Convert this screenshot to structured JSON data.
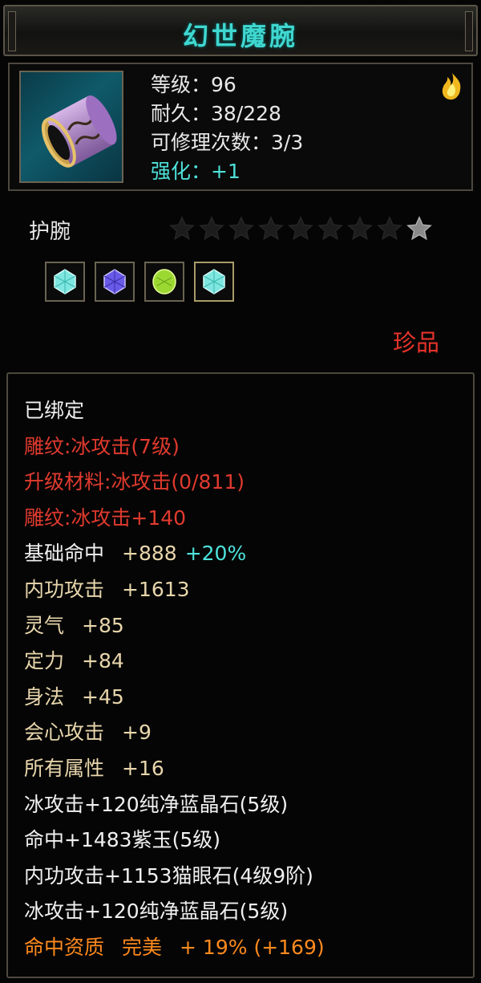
{
  "item": {
    "name": "幻世魔腕",
    "type": "护腕",
    "rarity": "珍品",
    "stats": [
      {
        "label": "等级：",
        "value": "96"
      },
      {
        "label": "耐久：",
        "value": "38/228"
      },
      {
        "label": "可修理次数：",
        "value": "3/3"
      },
      {
        "label": "强化：",
        "value": "+1"
      }
    ],
    "stars": {
      "filled": 1,
      "total": 9
    },
    "gems": [
      "cyan-gem",
      "purple-gem",
      "green-gem",
      "cyan-gem"
    ],
    "icon": "bracer-icon",
    "corner_icon": "fire-icon"
  },
  "attributes": {
    "bound": "已绑定",
    "engraving": "雕纹:冰攻击(7级)",
    "upgrade_material": "升级材料:冰攻击(0/811)",
    "engraving_bonus": "雕纹:冰攻击+140",
    "base_stats": [
      {
        "name": "基础命中",
        "value": "+888",
        "extra": "+20%"
      },
      {
        "name": "内功攻击",
        "value": "+1613"
      },
      {
        "name": "灵气",
        "value": "+85"
      },
      {
        "name": "定力",
        "value": "+84"
      },
      {
        "name": "身法",
        "value": "+45"
      },
      {
        "name": "会心攻击",
        "value": "+9"
      },
      {
        "name": "所有属性",
        "value": "+16"
      }
    ],
    "gem_lines": [
      "冰攻击+120纯净蓝晶石(5级)",
      "命中+1483紫玉(5级)",
      "内功攻击+1153猫眼石(4级9阶)",
      "冰攻击+120纯净蓝晶石(5级)"
    ],
    "quality": {
      "name": "命中资质",
      "grade": "完美",
      "value": "+ 19% (+169)"
    }
  },
  "colors": {
    "title": "#3fd8d0",
    "rarity": "#e5332a",
    "engraving": "#e03a2e",
    "stat_name": "#e8d6ac",
    "percent": "#4de2dc",
    "quality": "#ff8a1e"
  }
}
